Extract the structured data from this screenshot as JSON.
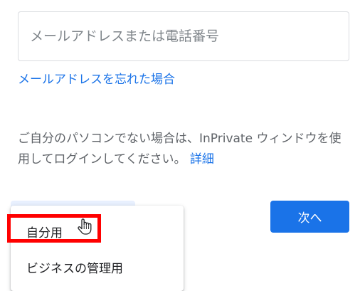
{
  "email": {
    "placeholder": "メールアドレスまたは電話番号",
    "value": ""
  },
  "links": {
    "forgot_email": "メールアドレスを忘れた場合"
  },
  "notice": {
    "text": "ご自分のパソコンでない場合は、InPrivate ウィンドウを使用してログインしてください。",
    "learn_more": "詳細"
  },
  "buttons": {
    "next": "次へ"
  },
  "account_menu": {
    "items": [
      "自分用",
      "ビジネスの管理用"
    ]
  },
  "colors": {
    "accent": "#1a73e8",
    "highlight": "#ff0000"
  },
  "icons": {
    "cursor": "hand-pointer-icon"
  }
}
